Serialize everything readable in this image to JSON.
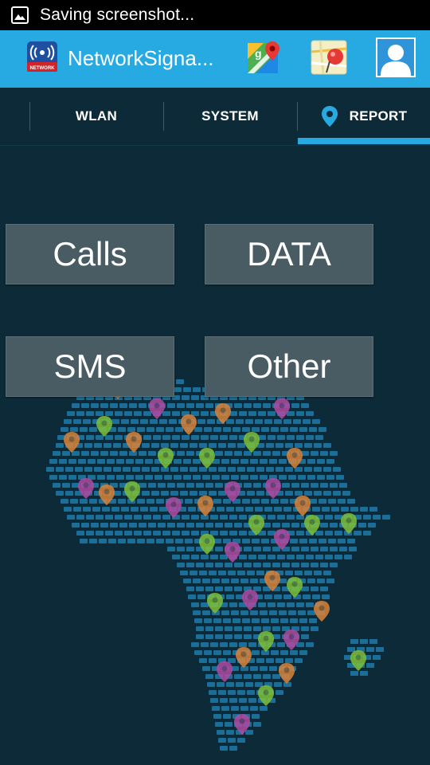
{
  "status_bar": {
    "text": "Saving screenshot..."
  },
  "action_bar": {
    "title": "NetworkSigna...",
    "app_icon_label": "NETWORK"
  },
  "tabs": [
    {
      "label": "WLAN",
      "selected": false
    },
    {
      "label": "SYSTEM",
      "selected": false
    },
    {
      "label": "REPORT",
      "selected": true
    }
  ],
  "report_buttons": {
    "calls": "Calls",
    "data": "DATA",
    "sms": "SMS",
    "other": "Other"
  },
  "colors": {
    "action_bar": "#27a9e1",
    "background": "#0c2a38",
    "button": "#4a5c63",
    "tab_indicator": "#27a9e1"
  },
  "icons": {
    "status": "image-icon",
    "maps": "google-maps-icon",
    "map_pin": "map-pin-icon",
    "account": "account-icon",
    "tab_report": "location-pin-icon"
  }
}
